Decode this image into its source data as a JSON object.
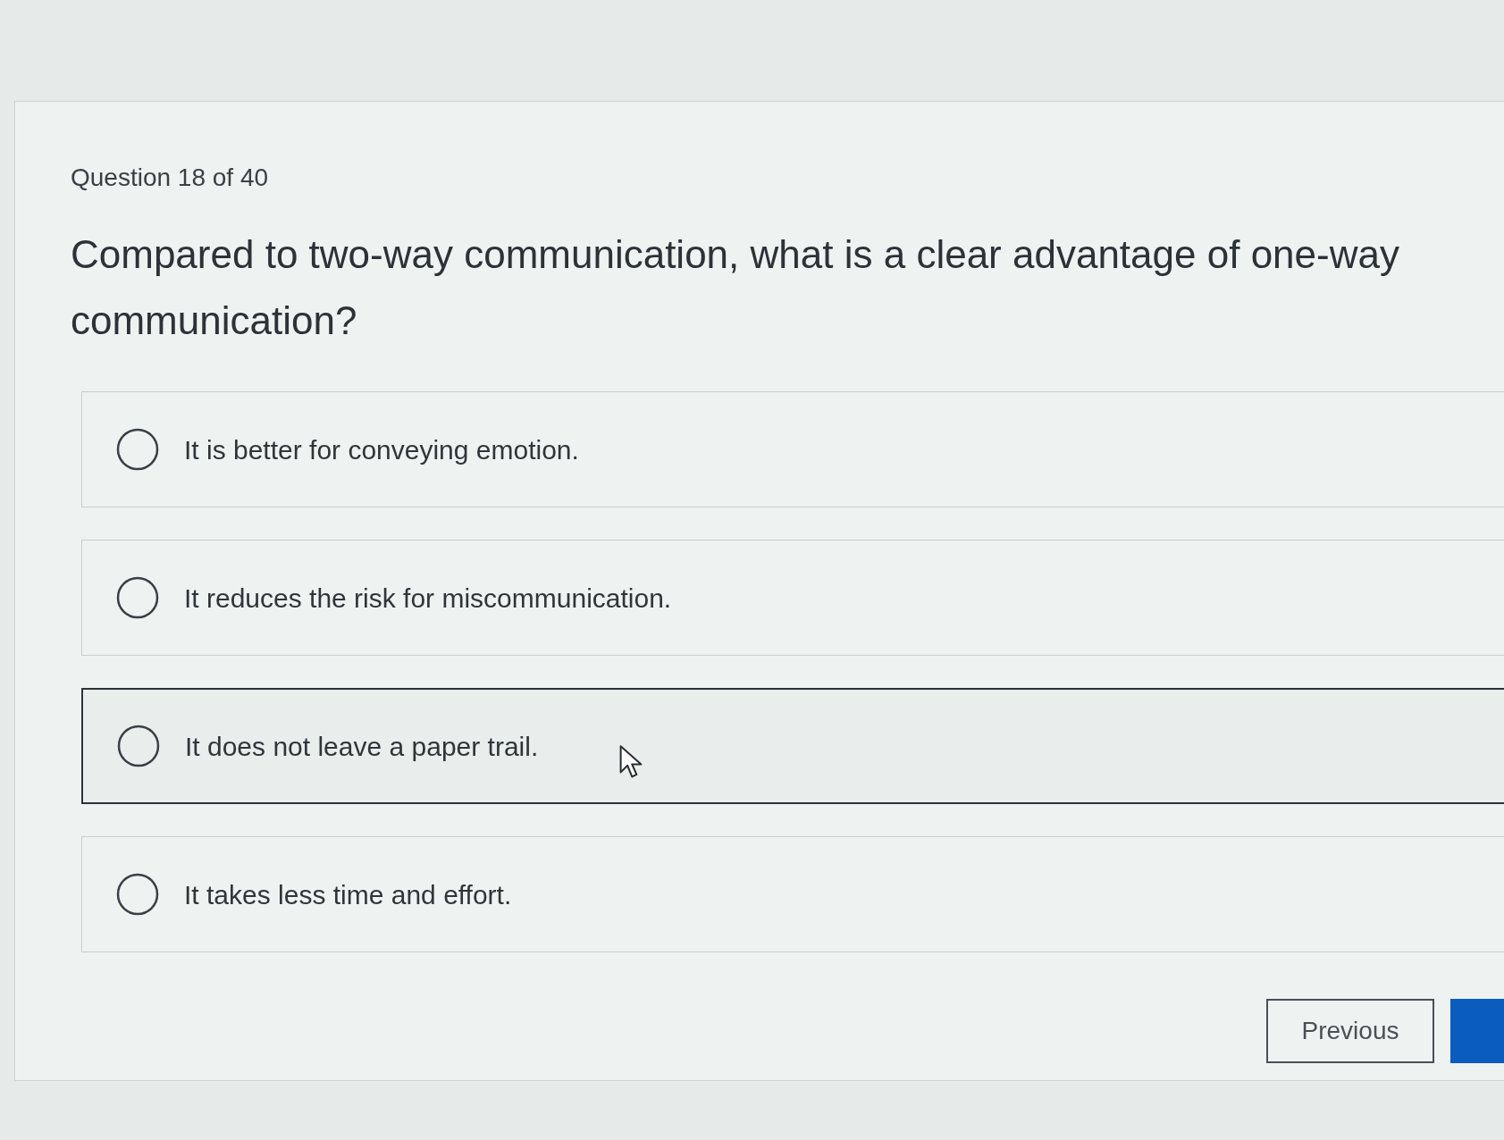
{
  "header": {
    "progress": "Question 18 of 40"
  },
  "question": {
    "text": "Compared to two-way communication, what is a clear advantage of one-way communication?"
  },
  "options": [
    {
      "label": "It is better for conveying emotion.",
      "selected": false,
      "hovered": false
    },
    {
      "label": "It reduces the risk for miscommunication.",
      "selected": false,
      "hovered": false
    },
    {
      "label": "It does not leave a paper trail.",
      "selected": false,
      "hovered": true
    },
    {
      "label": "It takes less time and effort.",
      "selected": false,
      "hovered": false
    }
  ],
  "buttons": [
    {
      "kind": "secondary",
      "label": "Previous"
    },
    {
      "kind": "primary"
    }
  ]
}
